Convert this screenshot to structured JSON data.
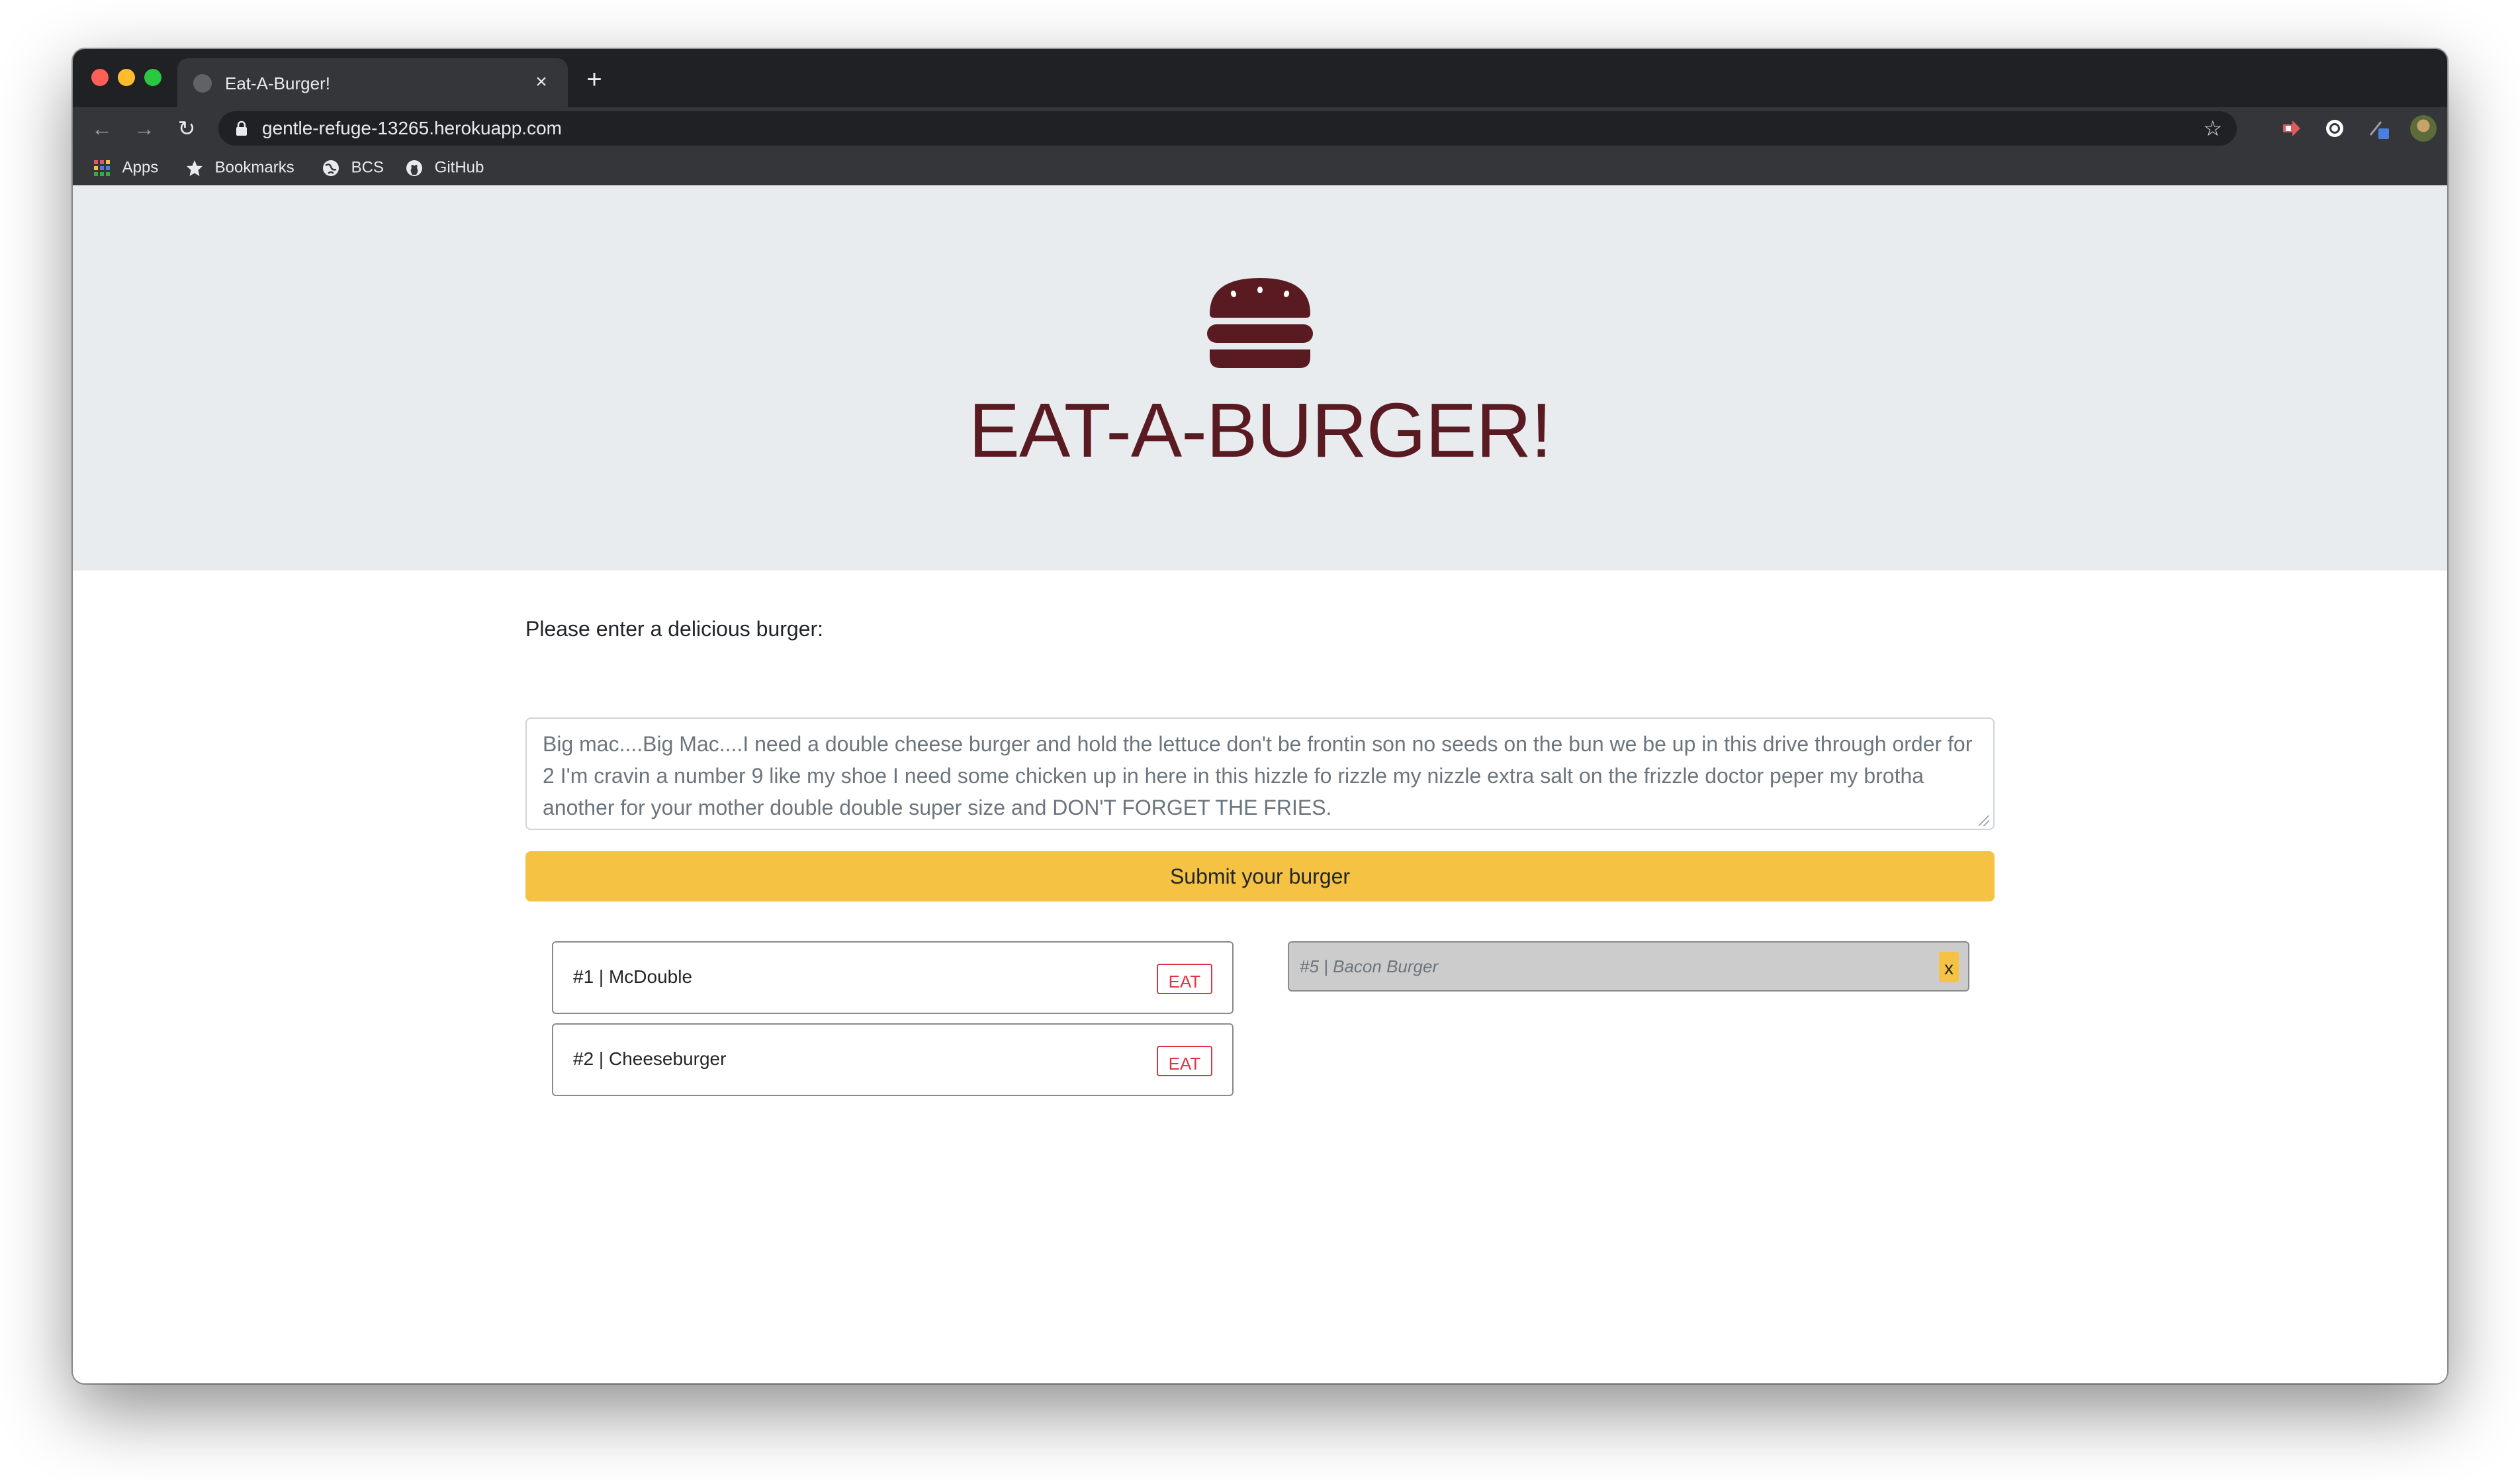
{
  "browser": {
    "tab_title": "Eat-A-Burger!",
    "tab_close": "×",
    "new_tab": "+",
    "url": "gentle-refuge-13265.herokuapp.com",
    "back": "←",
    "forward": "→",
    "reload": "↻",
    "star": "☆",
    "bookmarks": [
      {
        "label": "Apps",
        "icon": "apps-grid-icon"
      },
      {
        "label": "Bookmarks",
        "icon": "star-icon"
      },
      {
        "label": "BCS",
        "icon": "globe-icon"
      },
      {
        "label": "GitHub",
        "icon": "github-icon"
      }
    ]
  },
  "hero": {
    "icon": "hamburger-icon",
    "title": "EAT-A-BURGER!"
  },
  "form": {
    "label": "Please enter a delicious burger:",
    "textarea_value": "Big mac....Big Mac....I need a double cheese burger and hold the lettuce don't be frontin son no seeds on the bun we be up in this drive through order for 2 I'm cravin a number 9 like my shoe I need some chicken up in here in this hizzle fo rizzle my nizzle extra salt on the frizzle doctor peper my brotha another for your mother double double super size and DON'T FORGET THE FRIES.",
    "submit_label": "Submit your burger"
  },
  "burgers_to_eat": [
    {
      "name": "#1 | McDouble",
      "button": "EAT"
    },
    {
      "name": "#2 | Cheeseburger",
      "button": "EAT"
    }
  ],
  "devoured_burgers": [
    {
      "name": "#5 | Bacon Burger",
      "button": "x"
    }
  ],
  "colors": {
    "accent": "#f6c244",
    "brand": "#5a1a22",
    "danger": "#dc3545",
    "jumbotron_bg": "#e9ecef"
  }
}
